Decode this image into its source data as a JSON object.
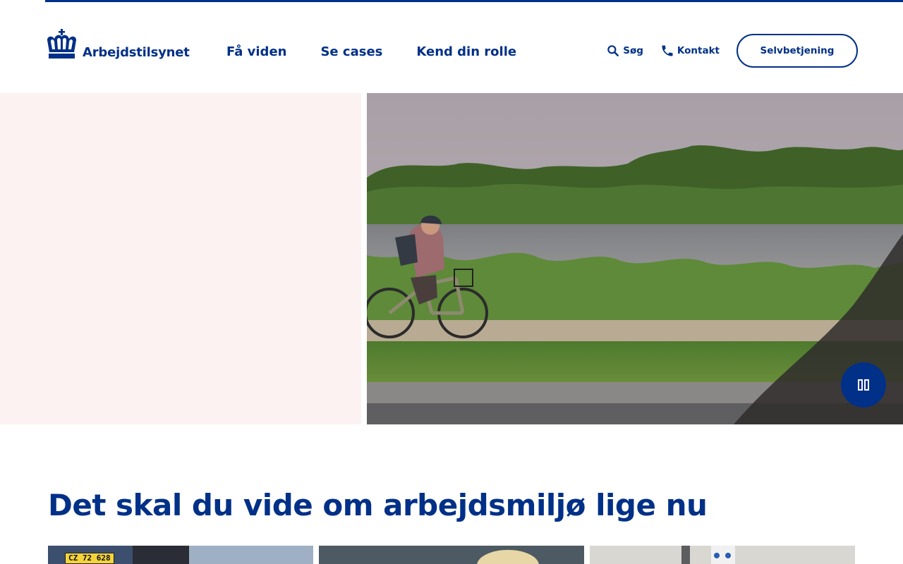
{
  "brand": {
    "name": "Arbejdstilsynet",
    "logo_icon": "crown-icon",
    "color": "#003087"
  },
  "nav": {
    "items": [
      {
        "label": "Få viden"
      },
      {
        "label": "Se cases"
      },
      {
        "label": "Kend din rolle"
      }
    ]
  },
  "utility": {
    "search_label": "Søg",
    "search_icon": "search-icon",
    "contact_label": "Kontakt",
    "contact_icon": "phone-icon",
    "selfservice_label": "Selvbetjening"
  },
  "hero": {
    "panel_color": "#fcf2f2",
    "image": "cyclist-by-lake-photo",
    "pause_icon": "pause-icon"
  },
  "section": {
    "title": "Det skal du vide om arbejdsmiljø lige nu"
  },
  "cards": [
    {
      "image": "car-photo",
      "plate_text": "CZ 72 628"
    },
    {
      "image": "person-photo"
    },
    {
      "image": "equipment-photo"
    }
  ]
}
